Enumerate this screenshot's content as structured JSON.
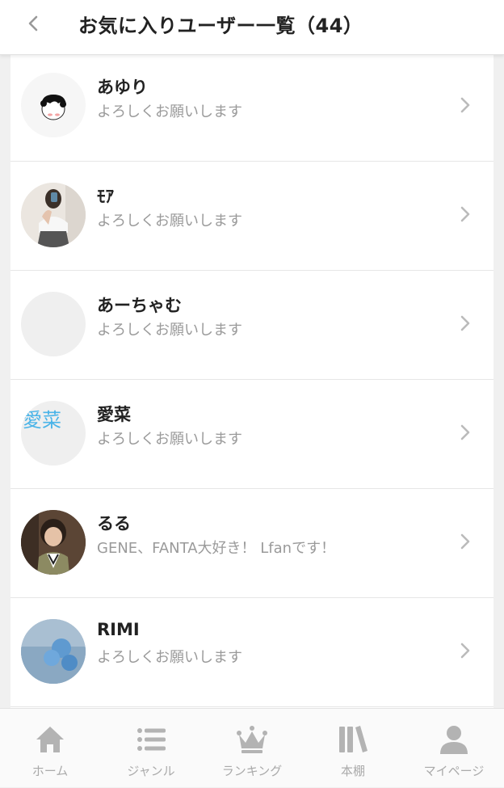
{
  "header": {
    "title": "お気に入りユーザー一覧（44）"
  },
  "users": [
    {
      "name": "あゆり",
      "description": "よろしくお願いします"
    },
    {
      "name": "ﾓｱ",
      "description": "よろしくお願いします"
    },
    {
      "name": "あーちゃむ",
      "description": "よろしくお願いします"
    },
    {
      "name": "愛菜",
      "description": "よろしくお願いします",
      "avatar_text": "愛菜"
    },
    {
      "name": "るる",
      "description": "GENE、FANTA大好き！ Lfanです！"
    },
    {
      "name": "RIMI",
      "description": "よろしくお願いします"
    }
  ],
  "tabbar": {
    "items": [
      {
        "label": "ホーム",
        "icon": "home-icon"
      },
      {
        "label": "ジャンル",
        "icon": "list-icon"
      },
      {
        "label": "ランキング",
        "icon": "crown-icon"
      },
      {
        "label": "本棚",
        "icon": "bookshelf-icon"
      },
      {
        "label": "マイページ",
        "icon": "person-icon"
      }
    ]
  },
  "colors": {
    "tab_inactive": "#aaaaaa",
    "text_primary": "#222222",
    "text_secondary": "#9a9a9a",
    "chevron": "#bbbbbb"
  }
}
